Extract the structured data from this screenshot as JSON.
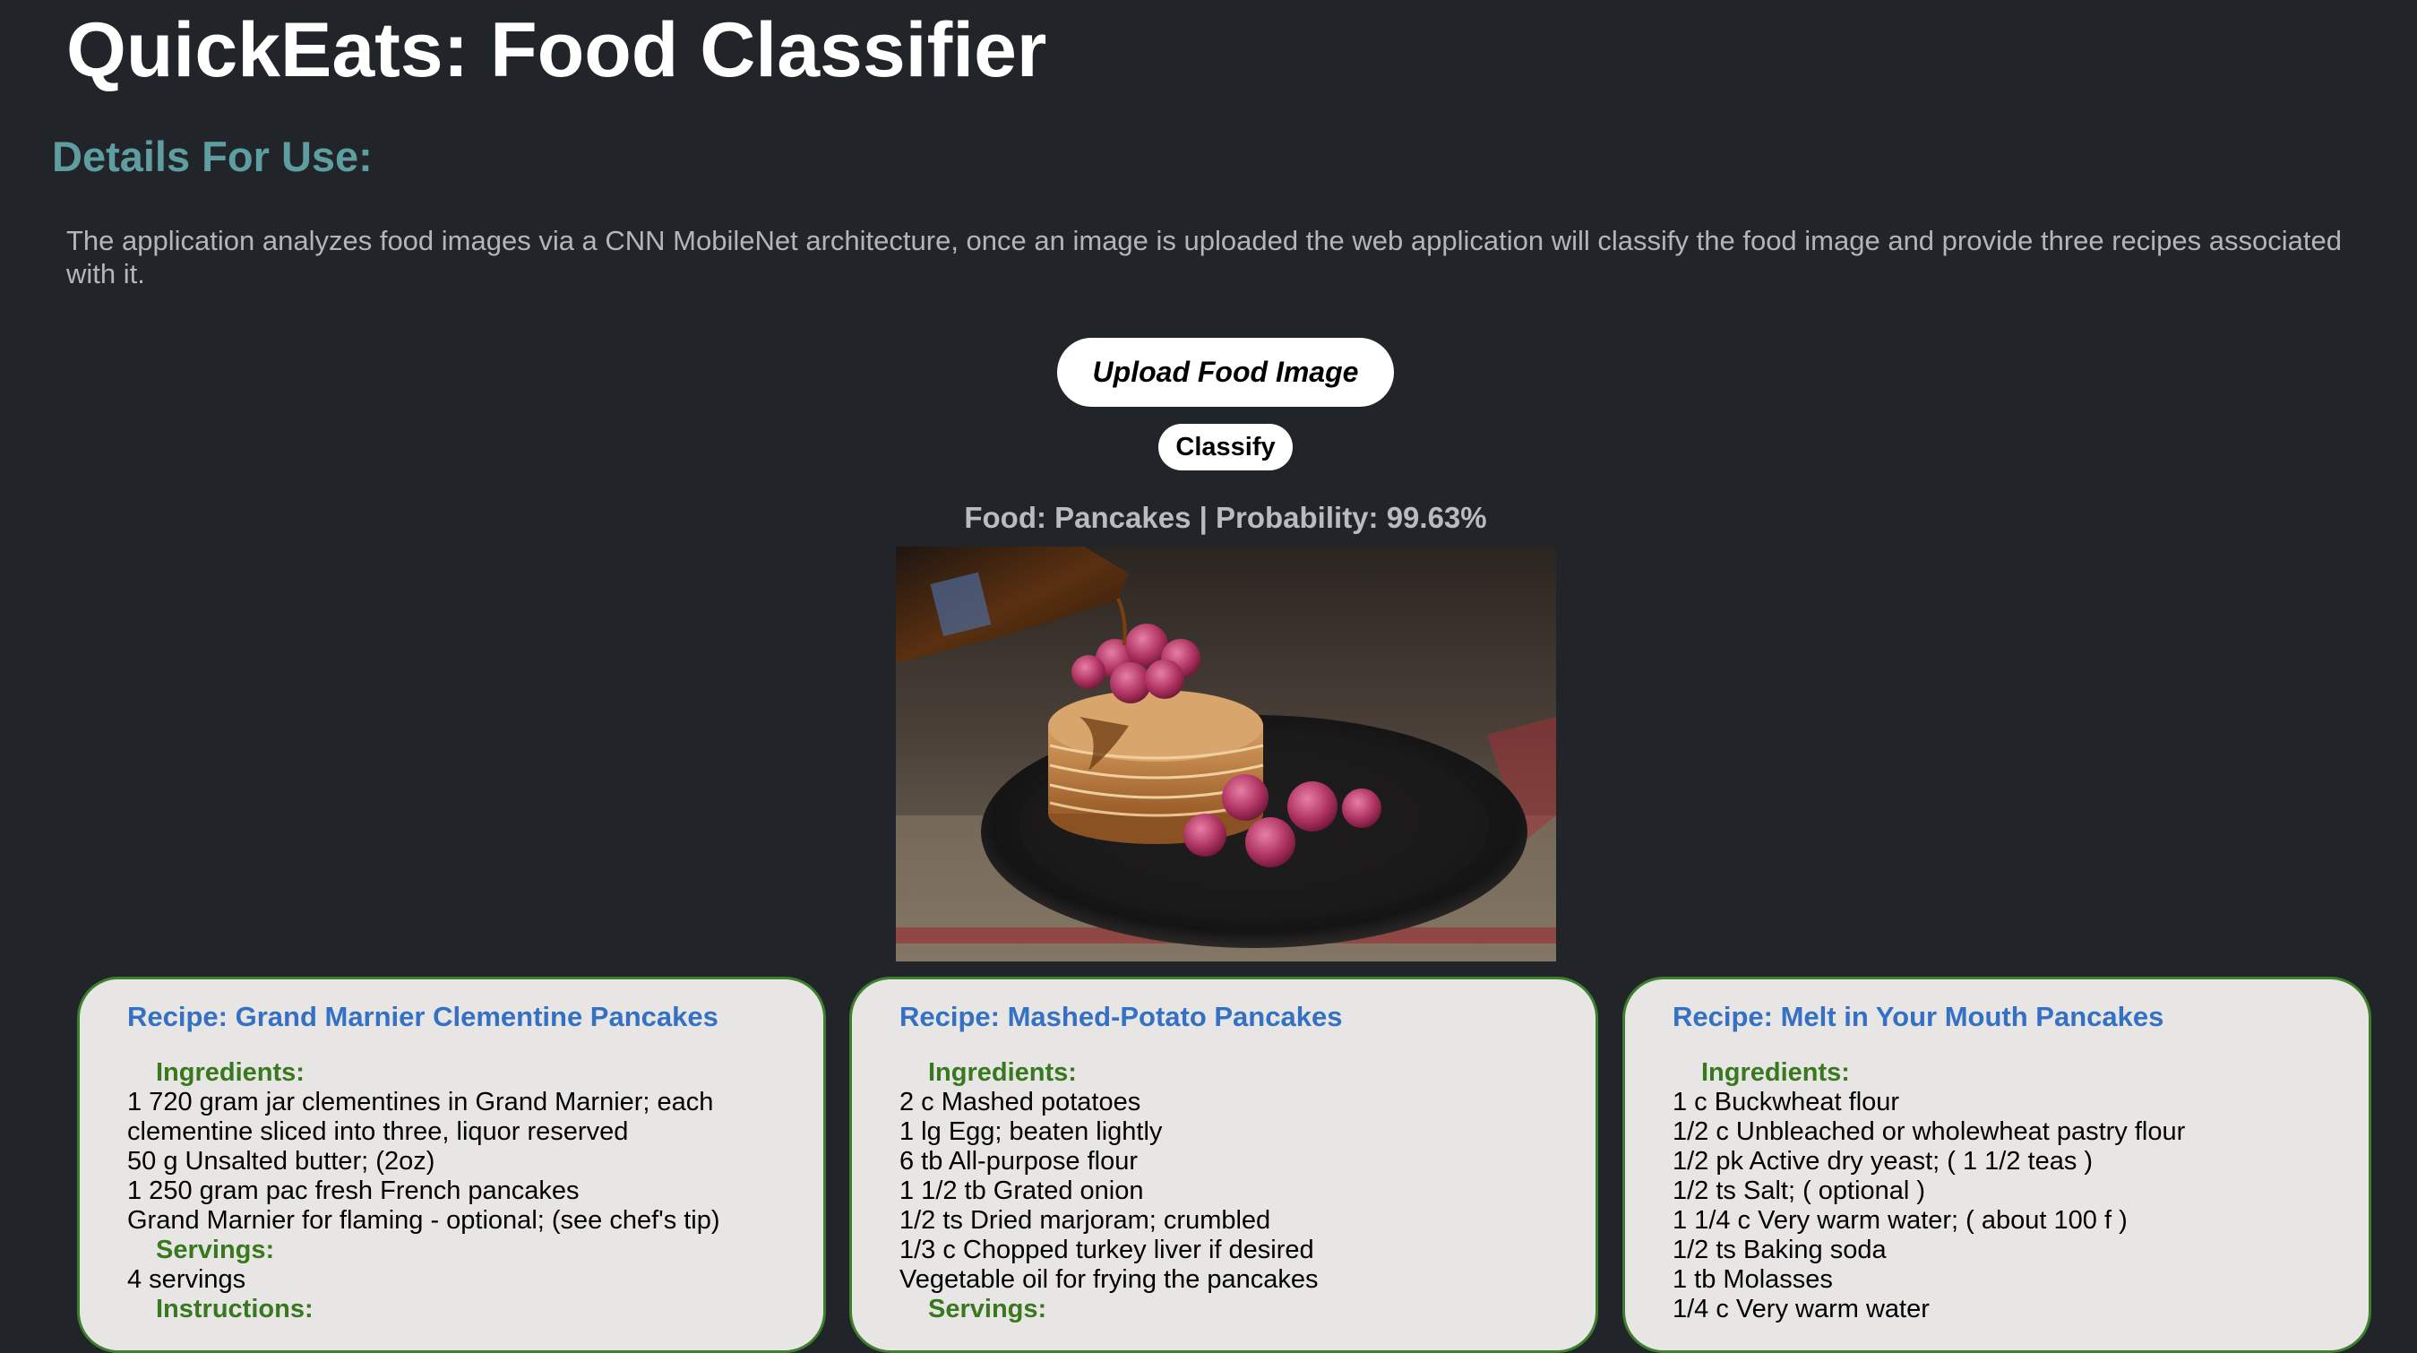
{
  "app": {
    "title": "QuickEats: Food Classifier"
  },
  "details": {
    "heading": "Details For Use:",
    "description": "The application analyzes food images via a CNN MobileNet architecture, once an image is uploaded the web application will classify the food image and provide three recipes associated with it."
  },
  "controls": {
    "upload_label": "Upload Food Image",
    "classify_label": "Classify"
  },
  "result": {
    "text": "Food: Pancakes | Probability: 99.63%",
    "food": "Pancakes",
    "probability_percent": 99.63
  },
  "image": {
    "alt": "Pancakes"
  },
  "recipes": [
    {
      "title": "Recipe: Grand Marnier Clementine Pancakes",
      "ingredients_label": "Ingredients:",
      "ingredients": [
        "1 720 gram jar clementines in Grand Marnier; each",
        "clementine sliced into three, liquor reserved",
        "50 g Unsalted butter; (2oz)",
        "1 250 gram pac fresh French pancakes",
        "Grand Marnier for flaming - optional; (see chef's tip)"
      ],
      "servings_label": "Servings:",
      "servings": "4 servings",
      "instructions_label": "Instructions:"
    },
    {
      "title": "Recipe: Mashed-Potato Pancakes",
      "ingredients_label": "Ingredients:",
      "ingredients": [
        "2 c Mashed potatoes",
        "1 lg Egg; beaten lightly",
        "6 tb All-purpose flour",
        "1 1/2 tb Grated onion",
        "1/2 ts Dried marjoram; crumbled",
        "1/3 c Chopped turkey liver if desired",
        "Vegetable oil for frying the pancakes"
      ],
      "servings_label": "Servings:"
    },
    {
      "title": "Recipe: Melt in Your Mouth Pancakes",
      "ingredients_label": "Ingredients:",
      "ingredients": [
        "1 c Buckwheat flour",
        "1/2 c Unbleached or wholewheat pastry flour",
        "1/2 pk Active dry yeast; ( 1 1/2 teas )",
        "1/2 ts Salt; ( optional )",
        "1 1/4 c Very warm water; ( about 100 f )",
        "1/2 ts Baking soda",
        "1 tb Molasses",
        "1/4 c Very warm water"
      ]
    }
  ],
  "colors": {
    "background": "#212429",
    "heading_accent": "#5f9ea0",
    "card_background": "#e8e6e4",
    "card_border": "#3d7f2c",
    "recipe_title": "#3470c4",
    "section_label": "#38781e"
  }
}
